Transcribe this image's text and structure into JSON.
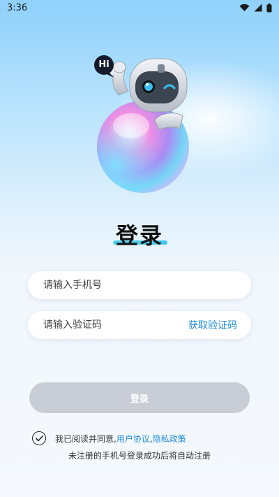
{
  "status_bar": {
    "time": "3:36"
  },
  "hero": {
    "bubble_text": "Hi"
  },
  "page": {
    "title": "登录"
  },
  "form": {
    "phone_placeholder": "请输入手机号",
    "phone_value": "",
    "code_placeholder": "请输入验证码",
    "code_value": "",
    "get_code_label": "获取验证码",
    "login_label": "登录"
  },
  "agreement": {
    "prefix": "我已阅读并同意,",
    "user_agreement": "用户协议",
    "separator": ",",
    "privacy_policy": "隐私政策",
    "note": "未注册的手机号登录成功后将自动注册",
    "checked": true
  },
  "colors": {
    "accent": "#1f8cd6",
    "button_disabled": "#c9ced6",
    "underline": "#4fd1ea"
  }
}
